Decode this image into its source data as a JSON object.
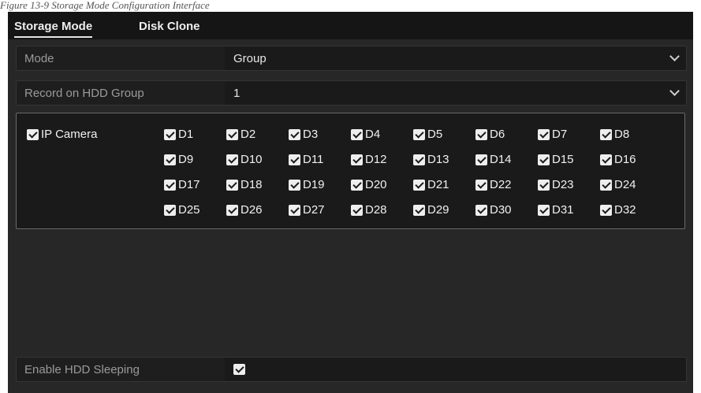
{
  "caption": "Figure 13-9 Storage Mode Configuration Interface",
  "tabs": {
    "storage_mode": "Storage Mode",
    "disk_clone": "Disk Clone"
  },
  "mode": {
    "label": "Mode",
    "value": "Group"
  },
  "record_group": {
    "label": "Record on HDD Group",
    "value": "1"
  },
  "ip_camera": {
    "label": "IP Camera",
    "checked": true,
    "channels": [
      "D1",
      "D2",
      "D3",
      "D4",
      "D5",
      "D6",
      "D7",
      "D8",
      "D9",
      "D10",
      "D11",
      "D12",
      "D13",
      "D14",
      "D15",
      "D16",
      "D17",
      "D18",
      "D19",
      "D20",
      "D21",
      "D22",
      "D23",
      "D24",
      "D25",
      "D26",
      "D27",
      "D28",
      "D29",
      "D30",
      "D31",
      "D32"
    ]
  },
  "hdd_sleeping": {
    "label": "Enable HDD Sleeping",
    "checked": true
  },
  "colors": {
    "panel_bg": "#272727",
    "tabbar_bg": "#151515",
    "checkbox": "#eeeeee"
  }
}
